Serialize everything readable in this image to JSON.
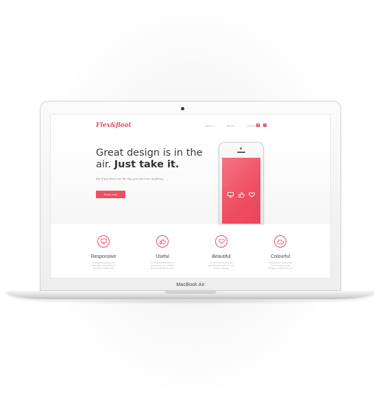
{
  "laptop": {
    "label": "MacBook Air"
  },
  "site": {
    "logo": "Flex&float",
    "nav": [
      "ABOUT",
      "WORK",
      "CONTACT"
    ],
    "social_icons": [
      "mail-icon",
      "facebook-icon"
    ],
    "social_glyphs": [
      "✉",
      "f"
    ],
    "headline_regular": "Great design is in the air.",
    "headline_bold": "Just take it.",
    "tagline": "But if you don't see the sky, you don't see anything.",
    "cta_label": "Read more",
    "phone_icons": [
      "monitor-icon",
      "thumbs-up-icon",
      "heart-icon"
    ],
    "features": [
      {
        "icon": "monitor-icon",
        "title": "Responsive",
        "desc": "It's beautiful because it's responsive, it's working on all of your mobile stuff."
      },
      {
        "icon": "thumbs-up-icon",
        "title": "Useful",
        "desc": "It's beautiful because it's great design. It's esthetic, simple and that's it's goal."
      },
      {
        "icon": "heart-icon",
        "title": "Beautiful",
        "desc": "It's so useful because it's beautiful and useful. It's very simple to change."
      },
      {
        "icon": "cloud-icon",
        "title": "Colourful",
        "desc": "There is lot of colours that you love and you can change it in every moment."
      }
    ]
  },
  "colors": {
    "accent": "#e84a5f",
    "button": "#ef4f5f",
    "text_dark": "#3a3a3a",
    "text_muted": "#aaaaaa"
  }
}
